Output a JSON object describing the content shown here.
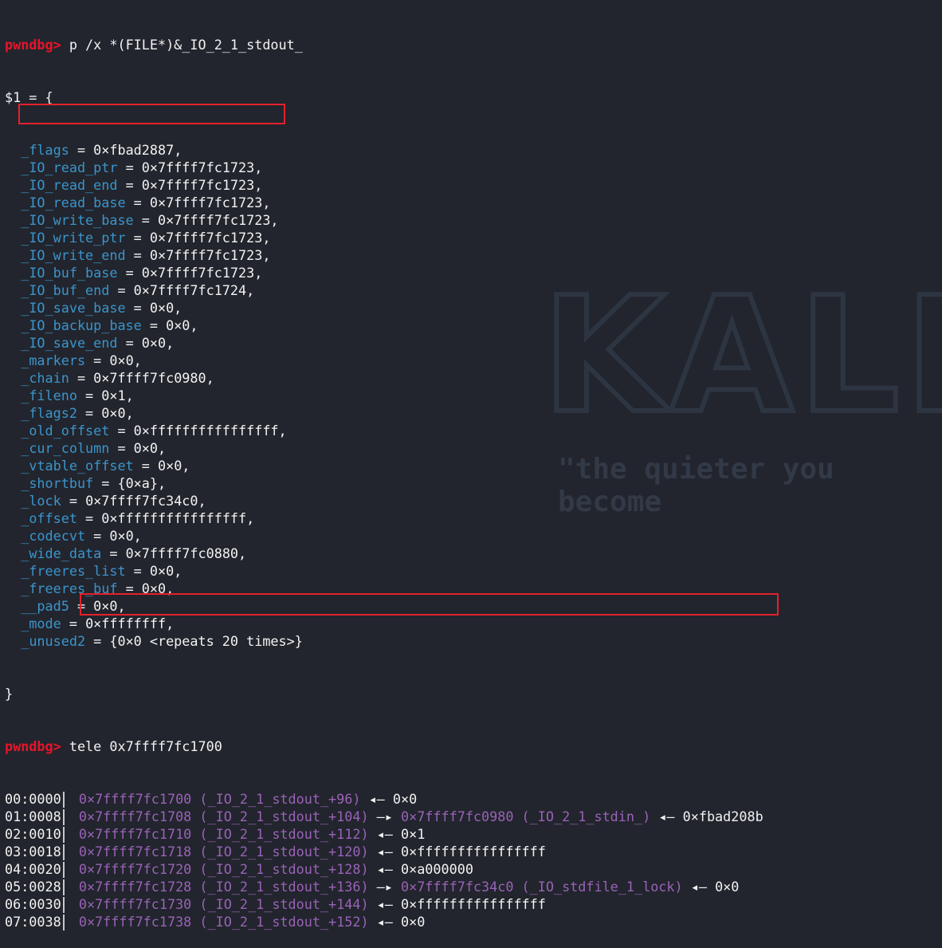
{
  "prompt": "pwndbg>",
  "command1": "p /x *(FILE*)&_IO_2_1_stdout_",
  "result_open": "$1 = {",
  "fields": [
    {
      "name": "_flags",
      "value": "0×fbad2887,"
    },
    {
      "name": "_IO_read_ptr",
      "value": "0×7ffff7fc1723,"
    },
    {
      "name": "_IO_read_end",
      "value": "0×7ffff7fc1723,"
    },
    {
      "name": "_IO_read_base",
      "value": "0×7ffff7fc1723,"
    },
    {
      "name": "_IO_write_base",
      "value": "0×7ffff7fc1723,",
      "highlight": true
    },
    {
      "name": "_IO_write_ptr",
      "value": "0×7ffff7fc1723,"
    },
    {
      "name": "_IO_write_end",
      "value": "0×7ffff7fc1723,"
    },
    {
      "name": "_IO_buf_base",
      "value": "0×7ffff7fc1723,"
    },
    {
      "name": "_IO_buf_end",
      "value": "0×7ffff7fc1724,"
    },
    {
      "name": "_IO_save_base",
      "value": "0×0,"
    },
    {
      "name": "_IO_backup_base",
      "value": "0×0,"
    },
    {
      "name": "_IO_save_end",
      "value": "0×0,"
    },
    {
      "name": "_markers",
      "value": "0×0,"
    },
    {
      "name": "_chain",
      "value": "0×7ffff7fc0980,"
    },
    {
      "name": "_fileno",
      "value": "0×1,"
    },
    {
      "name": "_flags2",
      "value": "0×0,"
    },
    {
      "name": "_old_offset",
      "value": "0×ffffffffffffffff,"
    },
    {
      "name": "_cur_column",
      "value": "0×0,"
    },
    {
      "name": "_vtable_offset",
      "value": "0×0,"
    },
    {
      "name": "_shortbuf",
      "value": "{0×a},"
    },
    {
      "name": "_lock",
      "value": "0×7ffff7fc34c0,"
    },
    {
      "name": "_offset",
      "value": "0×ffffffffffffffff,"
    },
    {
      "name": "_codecvt",
      "value": "0×0,"
    },
    {
      "name": "_wide_data",
      "value": "0×7ffff7fc0880,"
    },
    {
      "name": "_freeres_list",
      "value": "0×0,"
    },
    {
      "name": "_freeres_buf",
      "value": "0×0,"
    },
    {
      "name": "__pad5",
      "value": "0×0,"
    },
    {
      "name": "_mode",
      "value": "0×ffffffff,"
    },
    {
      "name": "_unused2",
      "value": "{0×0 <repeats 20 times>}"
    }
  ],
  "result_close": "}",
  "command2": "tele 0x7ffff7fc1700",
  "tele": [
    {
      "off": "00:0000",
      "addr": "0×7ffff7fc1700 (_IO_2_1_stdout_+96)",
      "arrow": "◂—",
      "ptr": "",
      "val": "0×0"
    },
    {
      "off": "01:0008",
      "addr": "0×7ffff7fc1708 (_IO_2_1_stdout_+104)",
      "arrow": "—▸",
      "ptr": "0×7ffff7fc0980 (_IO_2_1_stdin_)",
      "arrow2": "◂—",
      "val": "0×fbad208b",
      "highlight": true
    },
    {
      "off": "02:0010",
      "addr": "0×7ffff7fc1710 (_IO_2_1_stdout_+112)",
      "arrow": "◂—",
      "ptr": "",
      "val": "0×1"
    },
    {
      "off": "03:0018",
      "addr": "0×7ffff7fc1718 (_IO_2_1_stdout_+120)",
      "arrow": "◂—",
      "ptr": "",
      "val": "0×ffffffffffffffff"
    },
    {
      "off": "04:0020",
      "addr": "0×7ffff7fc1720 (_IO_2_1_stdout_+128)",
      "arrow": "◂—",
      "ptr": "",
      "val": "0×a000000"
    },
    {
      "off": "05:0028",
      "addr": "0×7ffff7fc1728 (_IO_2_1_stdout_+136)",
      "arrow": "—▸",
      "ptr": "0×7ffff7fc34c0 (_IO_stdfile_1_lock)",
      "arrow2": "◂—",
      "val": "0×0"
    },
    {
      "off": "06:0030",
      "addr": "0×7ffff7fc1730 (_IO_2_1_stdout_+144)",
      "arrow": "◂—",
      "ptr": "",
      "val": "0×ffffffffffffffff"
    },
    {
      "off": "07:0038",
      "addr": "0×7ffff7fc1738 (_IO_2_1_stdout_+152)",
      "arrow": "◂—",
      "ptr": "",
      "val": "0×0"
    }
  ],
  "wallpaper": {
    "logo": "KALI",
    "slogan": "\"the quieter you become"
  },
  "colors": {
    "background": "#22252d",
    "prompt": "#e8132a",
    "field": "#3b94cc",
    "address": "#9a62b8",
    "highlight_box": "#e5202b"
  }
}
